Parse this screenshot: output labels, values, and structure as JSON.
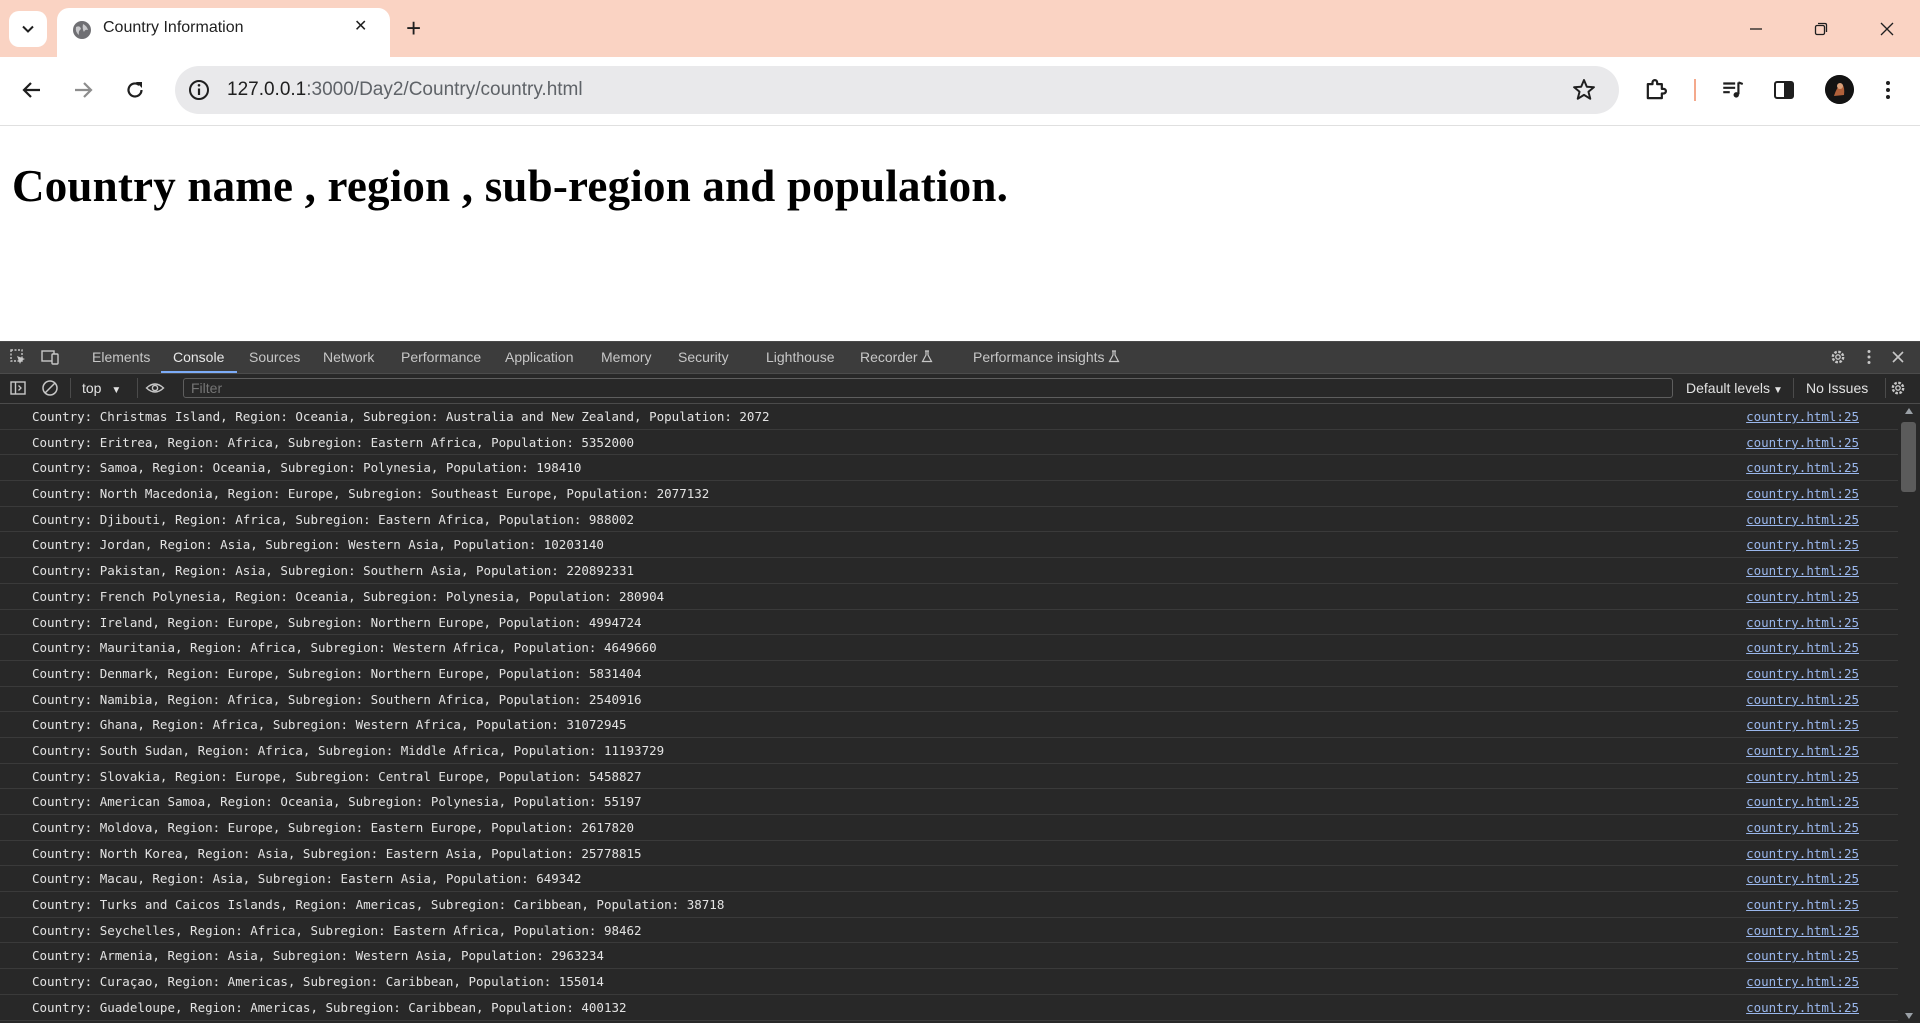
{
  "browser": {
    "tab_title": "Country Information",
    "url_host": "127.0.0.1",
    "url_path": ":3000/Day2/Country/country.html"
  },
  "page": {
    "heading": "Country name , region , sub-region and population."
  },
  "devtools": {
    "tabs": [
      "Elements",
      "Console",
      "Sources",
      "Network",
      "Performance",
      "Application",
      "Memory",
      "Security",
      "Lighthouse",
      "Recorder",
      "Performance insights"
    ],
    "active_tab": "Console",
    "context": "top",
    "filter_placeholder": "Filter",
    "levels": "Default levels",
    "issues": "No Issues",
    "logs": [
      {
        "msg": "Country: Christmas Island, Region: Oceania, Subregion: Australia and New Zealand, Population: 2072",
        "src": "country.html:25"
      },
      {
        "msg": "Country: Eritrea, Region: Africa, Subregion: Eastern Africa, Population: 5352000",
        "src": "country.html:25"
      },
      {
        "msg": "Country: Samoa, Region: Oceania, Subregion: Polynesia, Population: 198410",
        "src": "country.html:25"
      },
      {
        "msg": "Country: North Macedonia, Region: Europe, Subregion: Southeast Europe, Population: 2077132",
        "src": "country.html:25"
      },
      {
        "msg": "Country: Djibouti, Region: Africa, Subregion: Eastern Africa, Population: 988002",
        "src": "country.html:25"
      },
      {
        "msg": "Country: Jordan, Region: Asia, Subregion: Western Asia, Population: 10203140",
        "src": "country.html:25"
      },
      {
        "msg": "Country: Pakistan, Region: Asia, Subregion: Southern Asia, Population: 220892331",
        "src": "country.html:25"
      },
      {
        "msg": "Country: French Polynesia, Region: Oceania, Subregion: Polynesia, Population: 280904",
        "src": "country.html:25"
      },
      {
        "msg": "Country: Ireland, Region: Europe, Subregion: Northern Europe, Population: 4994724",
        "src": "country.html:25"
      },
      {
        "msg": "Country: Mauritania, Region: Africa, Subregion: Western Africa, Population: 4649660",
        "src": "country.html:25"
      },
      {
        "msg": "Country: Denmark, Region: Europe, Subregion: Northern Europe, Population: 5831404",
        "src": "country.html:25"
      },
      {
        "msg": "Country: Namibia, Region: Africa, Subregion: Southern Africa, Population: 2540916",
        "src": "country.html:25"
      },
      {
        "msg": "Country: Ghana, Region: Africa, Subregion: Western Africa, Population: 31072945",
        "src": "country.html:25"
      },
      {
        "msg": "Country: South Sudan, Region: Africa, Subregion: Middle Africa, Population: 11193729",
        "src": "country.html:25"
      },
      {
        "msg": "Country: Slovakia, Region: Europe, Subregion: Central Europe, Population: 5458827",
        "src": "country.html:25"
      },
      {
        "msg": "Country: American Samoa, Region: Oceania, Subregion: Polynesia, Population: 55197",
        "src": "country.html:25"
      },
      {
        "msg": "Country: Moldova, Region: Europe, Subregion: Eastern Europe, Population: 2617820",
        "src": "country.html:25"
      },
      {
        "msg": "Country: North Korea, Region: Asia, Subregion: Eastern Asia, Population: 25778815",
        "src": "country.html:25"
      },
      {
        "msg": "Country: Macau, Region: Asia, Subregion: Eastern Asia, Population: 649342",
        "src": "country.html:25"
      },
      {
        "msg": "Country: Turks and Caicos Islands, Region: Americas, Subregion: Caribbean, Population: 38718",
        "src": "country.html:25"
      },
      {
        "msg": "Country: Seychelles, Region: Africa, Subregion: Eastern Africa, Population: 98462",
        "src": "country.html:25"
      },
      {
        "msg": "Country: Armenia, Region: Asia, Subregion: Western Asia, Population: 2963234",
        "src": "country.html:25"
      },
      {
        "msg": "Country: Curaçao, Region: Americas, Subregion: Caribbean, Population: 155014",
        "src": "country.html:25"
      },
      {
        "msg": "Country: Guadeloupe, Region: Americas, Subregion: Caribbean, Population: 400132",
        "src": "country.html:25"
      }
    ]
  }
}
